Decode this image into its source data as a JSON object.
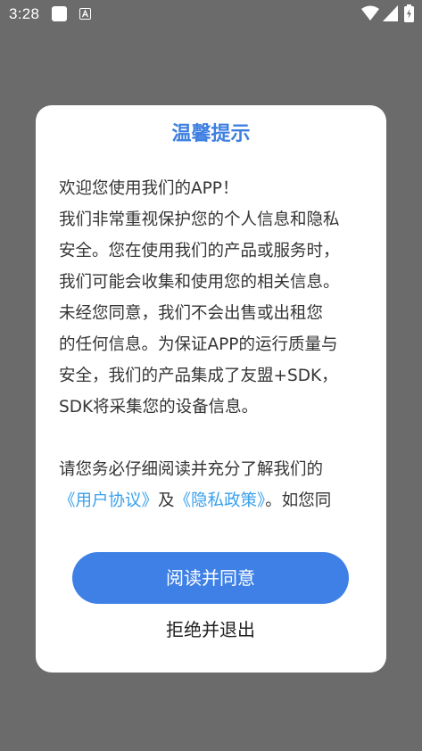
{
  "status_bar": {
    "time": "3:28",
    "icons": [
      "notification-square-icon",
      "a-box-icon",
      "wifi-icon",
      "signal-icon",
      "battery-charging-icon"
    ]
  },
  "dialog": {
    "title": "温馨提示",
    "paragraphs": [
      {
        "lines": [
          "欢迎您使用我们的APP！",
          "我们非常重视保护您的个人信息和隐私",
          "安全。您在使用我们的产品或服务时，",
          "我们可能会收集和使用您的相关信息。",
          "未经您同意，我们不会出售或出租您",
          "的任何信息。为保证APP的运行质量与",
          "安全，我们的产品集成了友盟+SDK，",
          "SDK将采集您的设备信息。"
        ]
      },
      {
        "line1": "请您务必仔细阅读并充分了解我们的",
        "user_agreement": "《用户协议》",
        "and": "及",
        "privacy_policy": "《隐私政策》",
        "tail": "。如您同"
      }
    ],
    "agree_label": "阅读并同意",
    "reject_label": "拒绝并退出"
  },
  "colors": {
    "overlay": "#6b6b6b",
    "title": "#3e7fe1",
    "link": "#39a0ec",
    "button": "#3e80e6"
  }
}
